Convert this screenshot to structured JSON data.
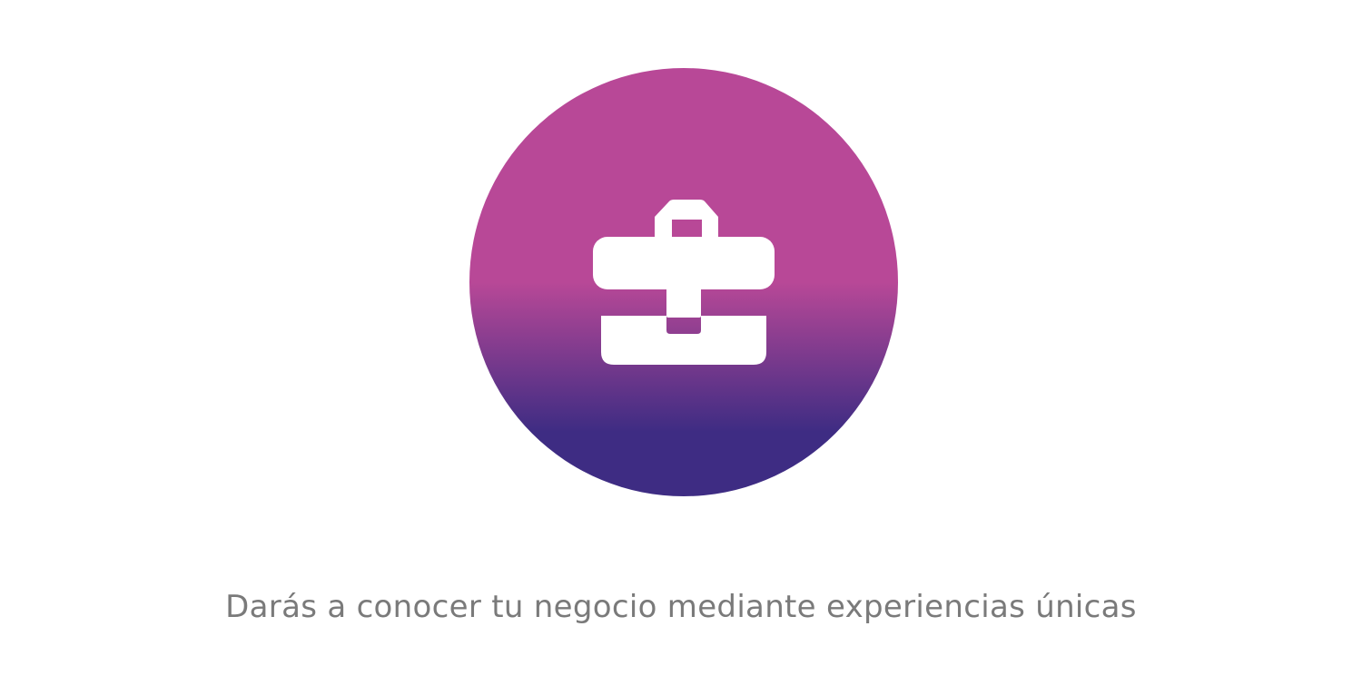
{
  "caption": {
    "text": "Darás a conocer tu negocio mediante experiencias únicas",
    "color": "#7a7a7a"
  },
  "badge": {
    "icon": "briefcase-icon",
    "icon_color": "#ffffff",
    "gradient_top_color": "#b84897",
    "gradient_bottom_color": "#3e2c83"
  }
}
